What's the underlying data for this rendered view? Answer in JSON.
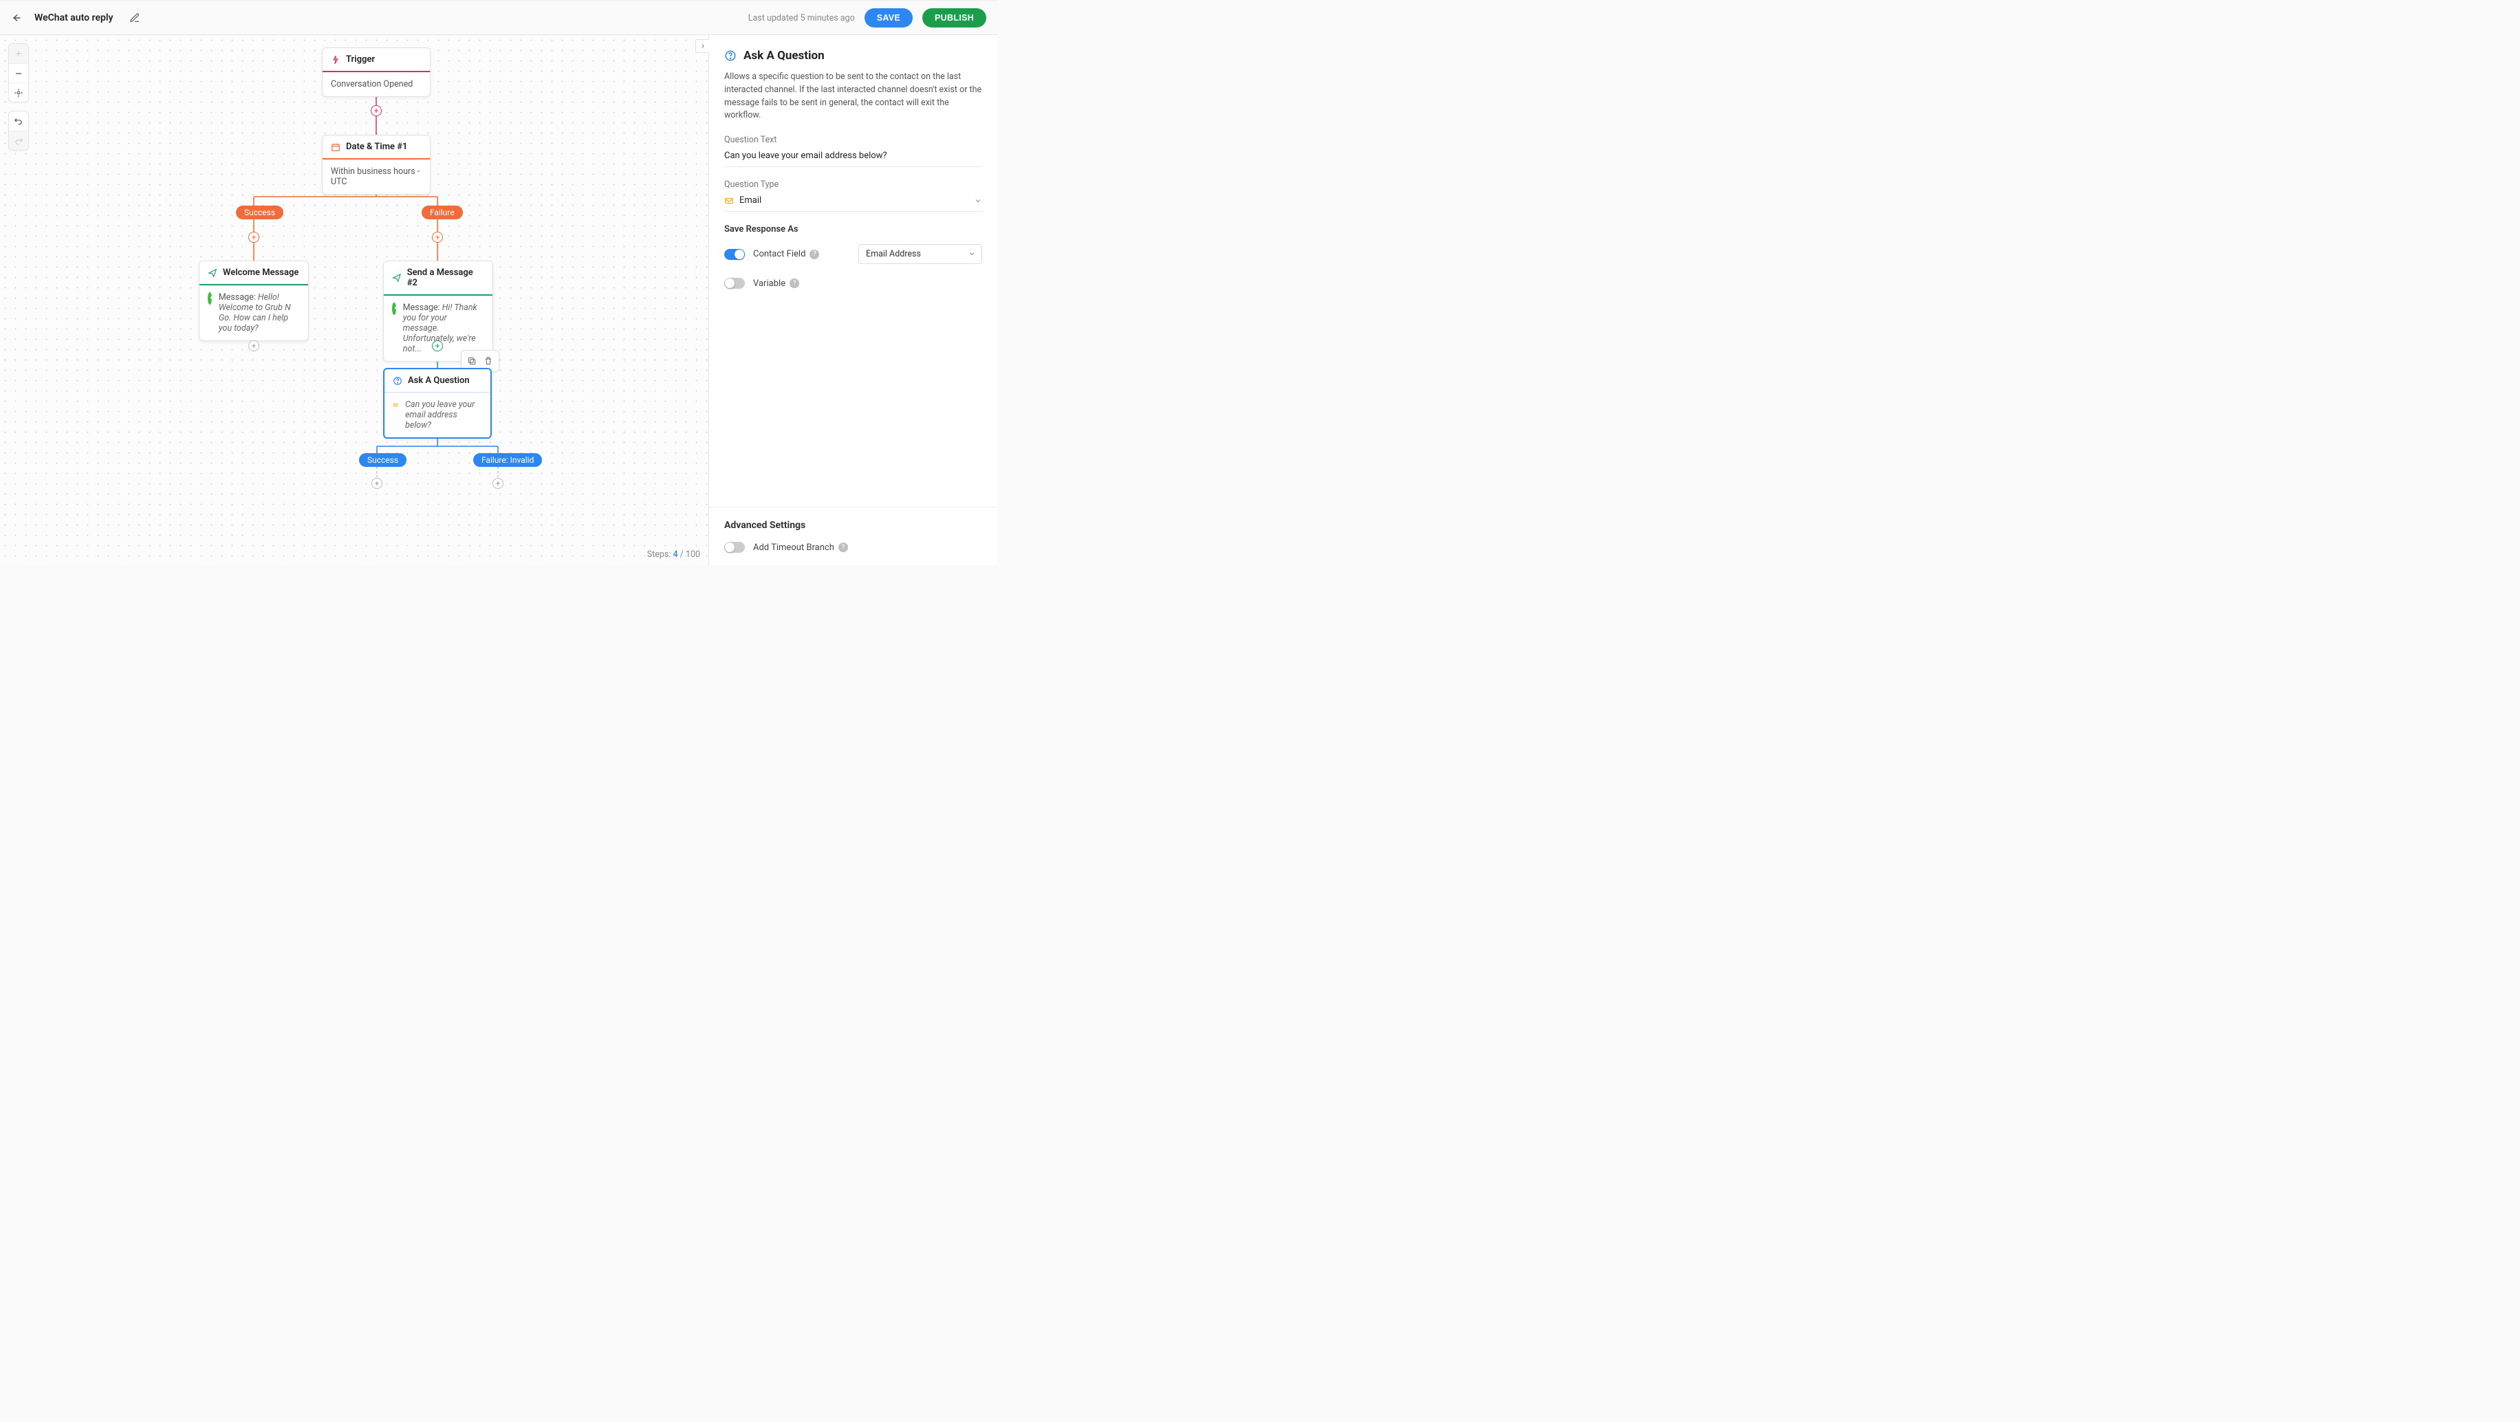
{
  "header": {
    "title": "WeChat auto reply",
    "last_updated": "Last updated 5 minutes ago",
    "save_label": "SAVE",
    "publish_label": "PUBLISH"
  },
  "footer": {
    "steps_label": "Steps:",
    "steps_current": "4",
    "steps_max": "100"
  },
  "nodes": {
    "trigger": {
      "title": "Trigger",
      "body": "Conversation Opened"
    },
    "datetime": {
      "title": "Date & Time #1",
      "body": "Within business hours - UTC"
    },
    "branches": {
      "success": "Success",
      "failure": "Failure"
    },
    "welcome": {
      "title": "Welcome Message",
      "label": "Message:",
      "body": "Hello! Welcome to Grub N Go. How can I help you today?"
    },
    "send2": {
      "title": "Send a Message #2",
      "label": "Message:",
      "body": "Hi! Thank you for your message. Unfortunately, we're not..."
    },
    "ask": {
      "title": "Ask A Question",
      "body": "Can you leave your email address below?"
    },
    "ask_branches": {
      "success": "Success",
      "failure": "Failure: Invalid"
    }
  },
  "panel": {
    "title": "Ask A Question",
    "description": "Allows a specific question to be sent to the contact on the last interacted channel. If the last interacted channel doesn't exist or the message fails to be sent in general, the contact will exit the workflow.",
    "question_text_label": "Question Text",
    "question_text_value": "Can you leave your email address below?",
    "question_type_label": "Question Type",
    "question_type_value": "Email",
    "save_response_label": "Save Response As",
    "contact_field_label": "Contact Field",
    "contact_field_value": "Email Address",
    "variable_label": "Variable",
    "advanced_title": "Advanced Settings",
    "timeout_label": "Add Timeout Branch"
  }
}
